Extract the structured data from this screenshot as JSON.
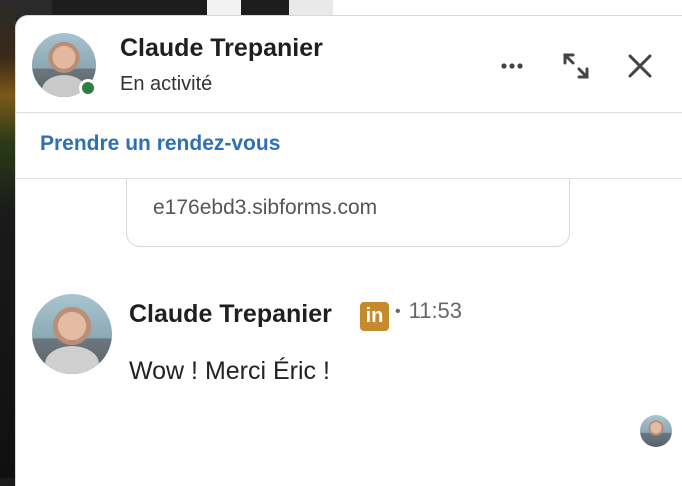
{
  "header": {
    "contact_name": "Claude Trepanier",
    "status": "En activité",
    "presence_color": "#2e7d45"
  },
  "subbar": {
    "schedule_link": "Prendre un rendez-vous",
    "link_color": "#2f6fb5"
  },
  "link_preview": {
    "domain": "e176ebd3.sibforms.com"
  },
  "message": {
    "sender": "Claude Trepanier",
    "badge": "in",
    "separator": "•",
    "time": "11:53",
    "text": "Wow ! Merci Éric !"
  },
  "icons": {
    "more": "more-horizontal-icon",
    "expand": "expand-icon",
    "close": "close-icon"
  }
}
